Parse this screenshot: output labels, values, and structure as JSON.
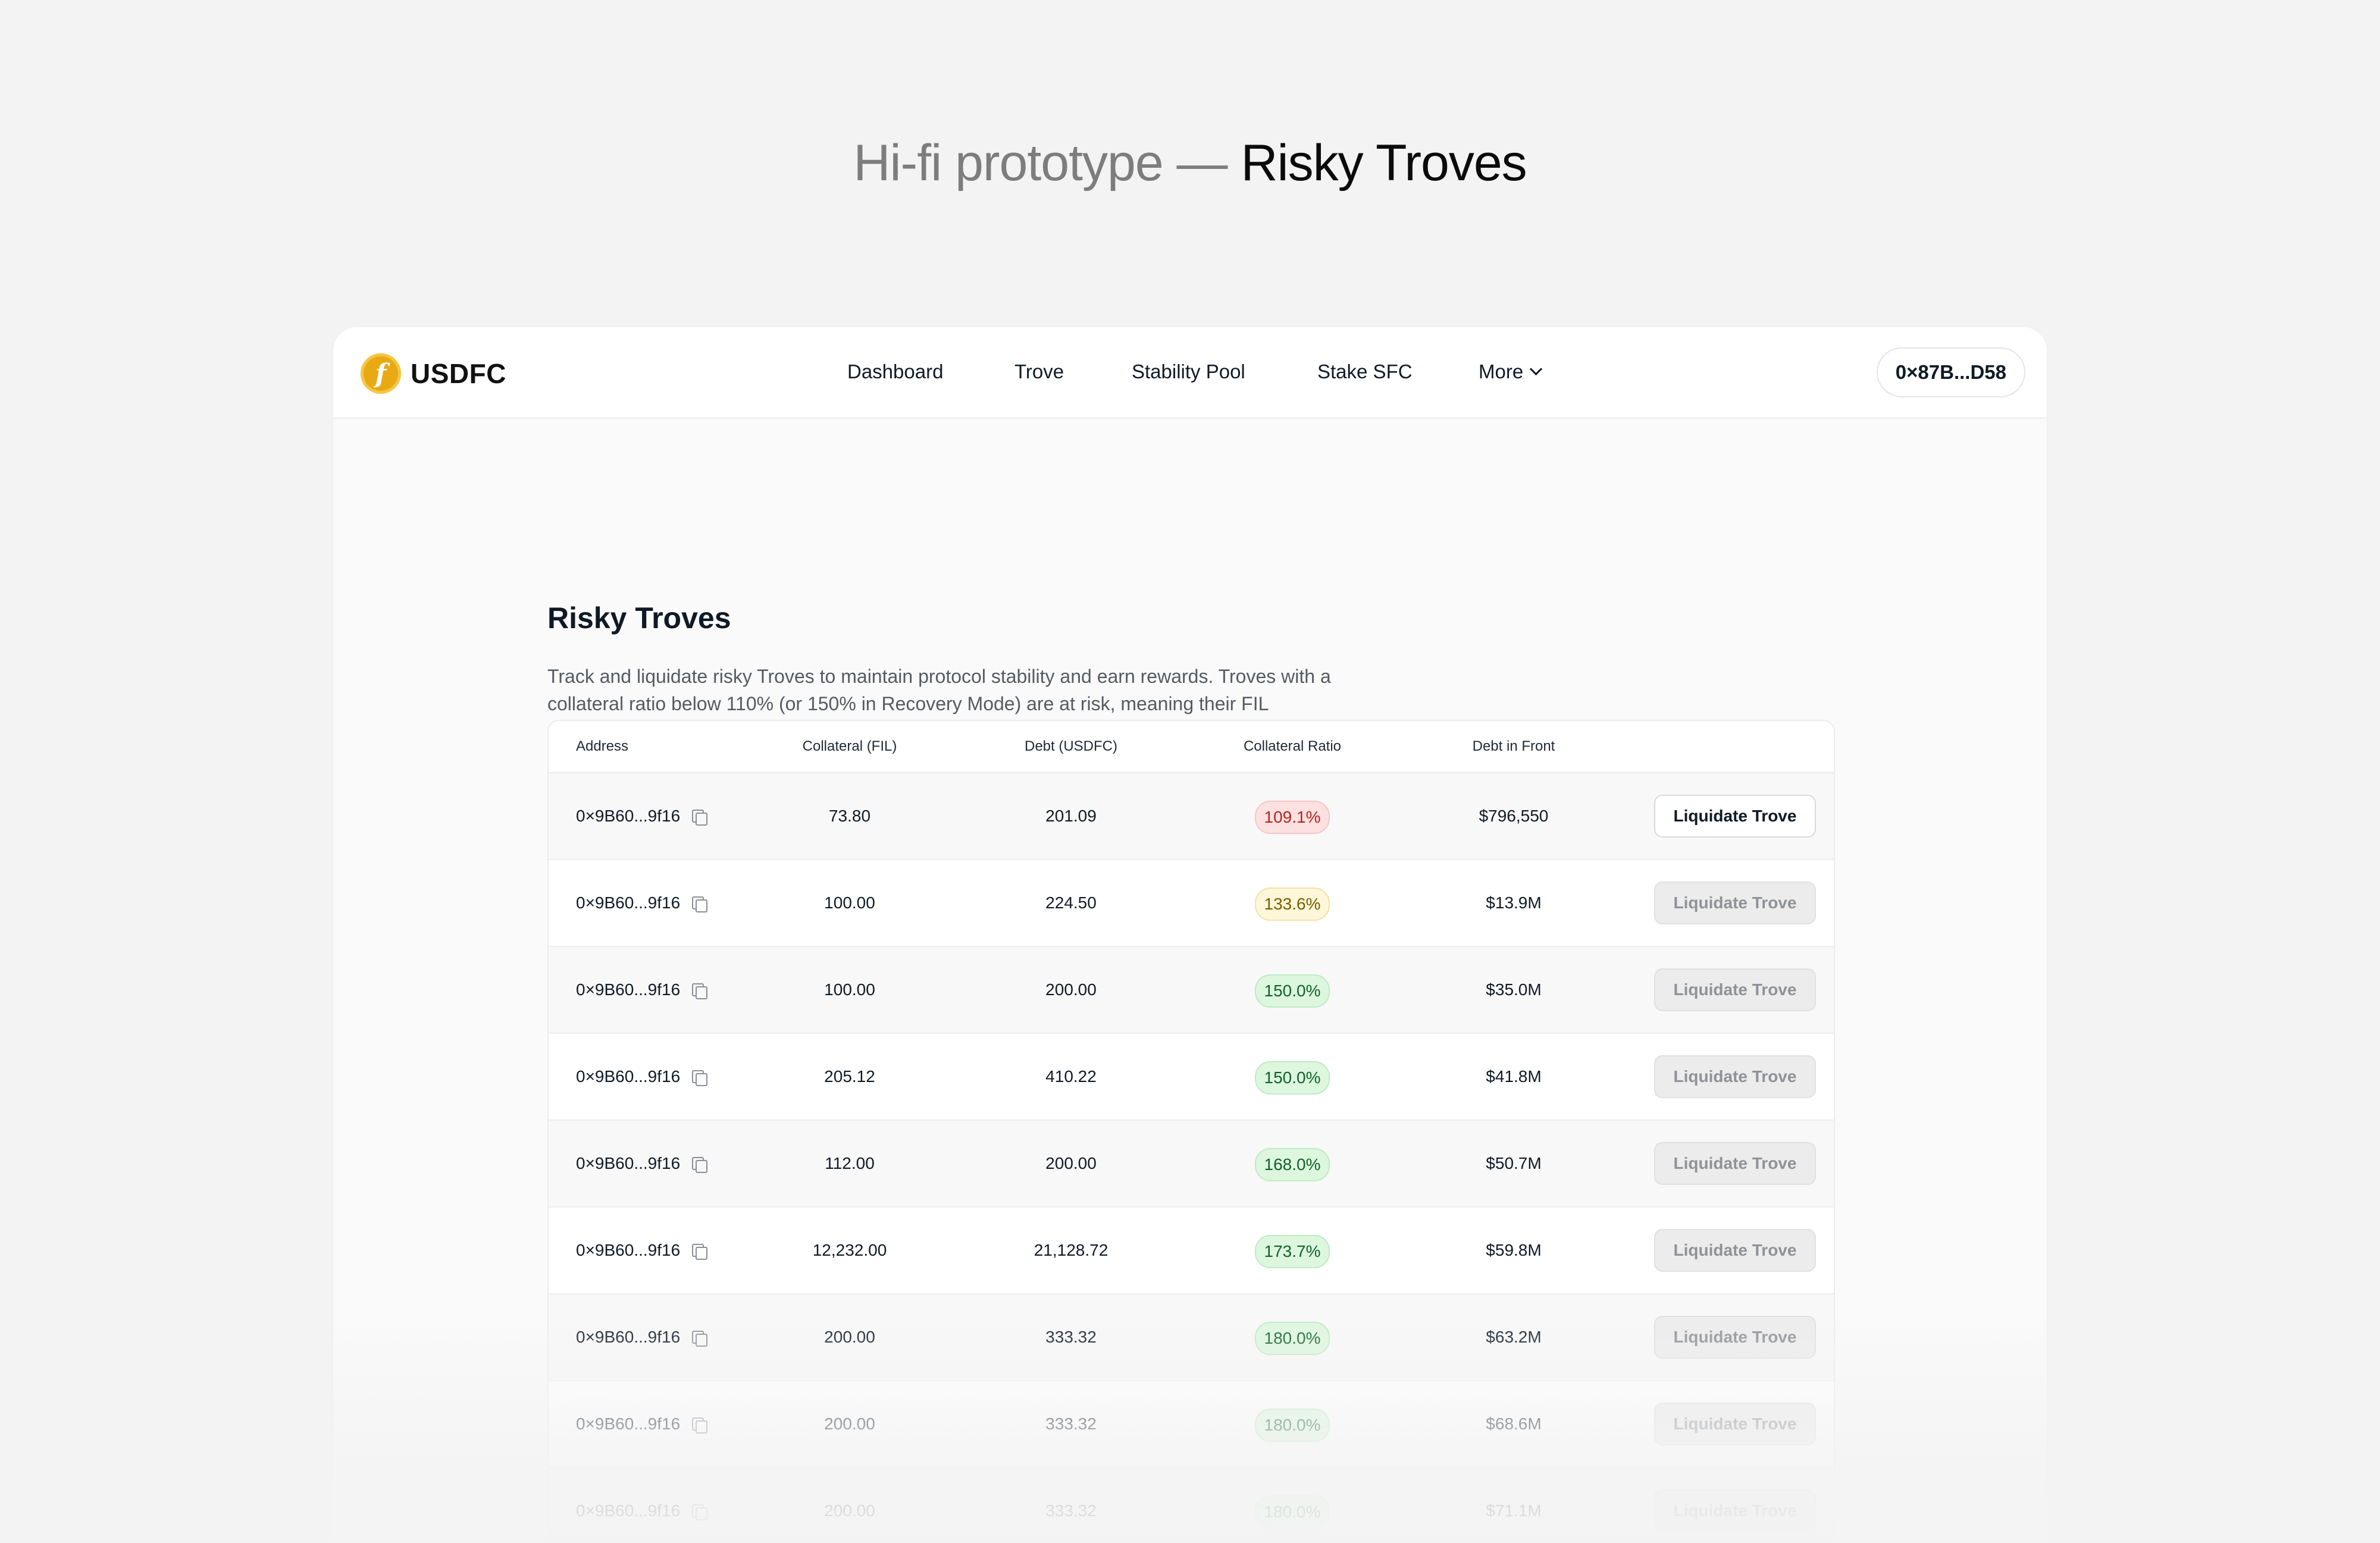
{
  "heading": {
    "prefix": "Hi-fi prototype — ",
    "title": "Risky Troves"
  },
  "app": {
    "logo_text": "USDFC",
    "logo_glyph": "f",
    "logo_icon": "usdfc-coin-icon",
    "nav": [
      "Dashboard",
      "Trove",
      "Stability Pool",
      "Stake SFC",
      "More"
    ],
    "wallet": "0×87B...D58",
    "colors": {
      "logo": "#e8a912",
      "danger": "#b3261e",
      "warning": "#7a5d00",
      "safe": "#11622a"
    }
  },
  "page": {
    "title": "Risky Troves",
    "description": "Track and liquidate risky Troves to maintain protocol stability and earn rewards. Troves with a collateral ratio below 110% (or 150% in Recovery Mode) are at risk, meaning their FIL collateral may not fully cover their debt."
  },
  "table": {
    "headers": [
      "Address",
      "Collateral (FIL)",
      "Debt (USDFC)",
      "Collateral Ratio",
      "Debt in Front"
    ],
    "action_label": "Liquidate Trove",
    "rows": [
      {
        "address": "0×9B60...9f16",
        "collateral": "73.80",
        "debt": "201.09",
        "ratio": "109.1%",
        "ratio_status": "red",
        "front": "$796,550",
        "action_enabled": true
      },
      {
        "address": "0×9B60...9f16",
        "collateral": "100.00",
        "debt": "224.50",
        "ratio": "133.6%",
        "ratio_status": "yellow",
        "front": "$13.9M",
        "action_enabled": false
      },
      {
        "address": "0×9B60...9f16",
        "collateral": "100.00",
        "debt": "200.00",
        "ratio": "150.0%",
        "ratio_status": "green",
        "front": "$35.0M",
        "action_enabled": false
      },
      {
        "address": "0×9B60...9f16",
        "collateral": "205.12",
        "debt": "410.22",
        "ratio": "150.0%",
        "ratio_status": "green",
        "front": "$41.8M",
        "action_enabled": false
      },
      {
        "address": "0×9B60...9f16",
        "collateral": "112.00",
        "debt": "200.00",
        "ratio": "168.0%",
        "ratio_status": "green",
        "front": "$50.7M",
        "action_enabled": false
      },
      {
        "address": "0×9B60...9f16",
        "collateral": "12,232.00",
        "debt": "21,128.72",
        "ratio": "173.7%",
        "ratio_status": "green",
        "front": "$59.8M",
        "action_enabled": false
      },
      {
        "address": "0×9B60...9f16",
        "collateral": "200.00",
        "debt": "333.32",
        "ratio": "180.0%",
        "ratio_status": "green",
        "front": "$63.2M",
        "action_enabled": false
      },
      {
        "address": "0×9B60...9f16",
        "collateral": "200.00",
        "debt": "333.32",
        "ratio": "180.0%",
        "ratio_status": "green",
        "front": "$68.6M",
        "action_enabled": false
      },
      {
        "address": "0×9B60...9f16",
        "collateral": "200.00",
        "debt": "333.32",
        "ratio": "180.0%",
        "ratio_status": "green",
        "front": "$71.1M",
        "action_enabled": false
      }
    ]
  }
}
